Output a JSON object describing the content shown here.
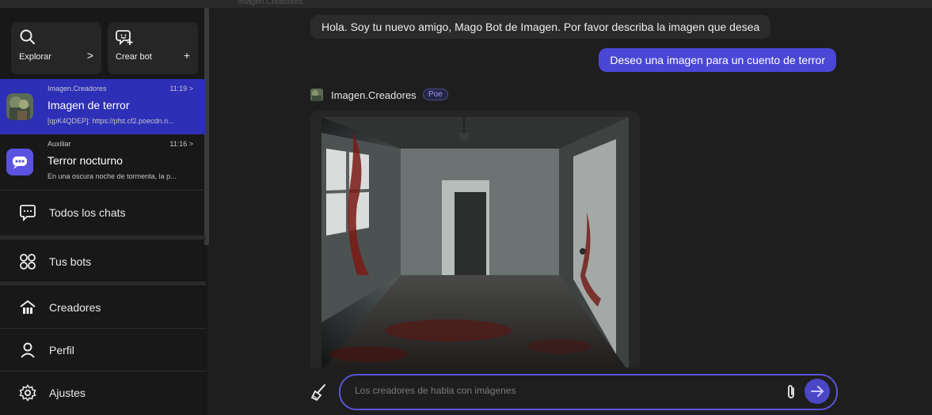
{
  "top_ghost": "Imagen.Creadores",
  "sidebar": {
    "explore": {
      "label": "Explorar",
      "action": ">"
    },
    "create": {
      "label": "Crear bot",
      "action": "+"
    },
    "chats": [
      {
        "bot": "Imagen.Creadores",
        "time": "11:19 >",
        "title": "Imagen de terror",
        "preview": "[qpK4QDEP]: https://pfst.cf2.poecdn.n..."
      },
      {
        "bot": "Auxiliar",
        "time": "11:16 >",
        "title": "Terror nocturno",
        "preview": "En una oscura noche de tormenta, la p..."
      }
    ],
    "nav": {
      "all_chats": "Todos los chats",
      "your_bots": "Tus bots",
      "creators": "Creadores",
      "profile": "Perfil",
      "settings": "Ajustes"
    }
  },
  "conversation": {
    "bot_greeting": "Hola. Soy tu nuevo amigo, Mago Bot de Imagen. Por favor describa la imagen que desea",
    "user_message": "Deseo una imagen para un cuento de terror",
    "reply_bot_name": "Imagen.Creadores",
    "reply_badge": "Poe"
  },
  "composer": {
    "placeholder": "Los creadores de habla con imágenes"
  },
  "colors": {
    "accent": "#4b47d6",
    "active_chat": "#2d2fb6",
    "background": "#1e1e1e",
    "sidebar": "#181818"
  }
}
